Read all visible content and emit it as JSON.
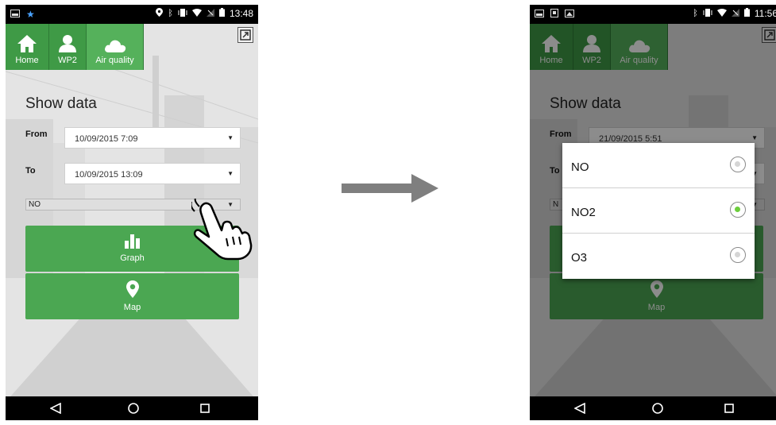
{
  "before": {
    "status_time": "13:48",
    "tabs": [
      {
        "label": "Home"
      },
      {
        "label": "WP2"
      },
      {
        "label": "Air quality"
      }
    ],
    "title": "Show data",
    "from_label": "From",
    "from_value": "10/09/2015 7:09",
    "to_label": "To",
    "to_value": "10/09/2015 13:09",
    "pollutant_value": "NO",
    "graph_label": "Graph",
    "map_label": "Map"
  },
  "after": {
    "status_time": "11:56",
    "tabs": [
      {
        "label": "Home"
      },
      {
        "label": "WP2"
      },
      {
        "label": "Air quality"
      }
    ],
    "title": "Show data",
    "from_label": "From",
    "from_value": "21/09/2015 5:51",
    "to_label": "To",
    "pollutant_value": "N",
    "map_label": "Map",
    "options": [
      {
        "label": "NO",
        "selected": false
      },
      {
        "label": "NO2",
        "selected": true
      },
      {
        "label": "O3",
        "selected": false
      }
    ]
  },
  "colors": {
    "green": "#4ba752",
    "tab_green": "#3f9a46",
    "radio_selected": "#6ccd3c",
    "arrow": "#7f7f7f"
  }
}
